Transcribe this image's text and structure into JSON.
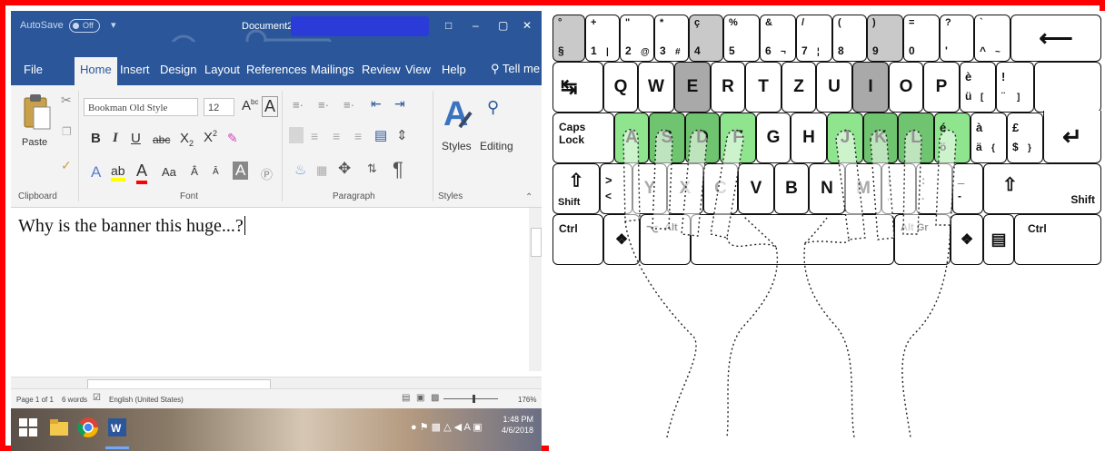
{
  "word": {
    "titlebar": {
      "autosave": "AutoSave",
      "autosave_state": "Off",
      "qat": "▾",
      "doc_title": "Document2 - Word",
      "win_restore": "□",
      "win_min": "–",
      "win_max": "▢",
      "win_close": "✕"
    },
    "tabs": [
      "File",
      "Home",
      "Insert",
      "Design",
      "Layout",
      "References",
      "Mailings",
      "Review",
      "View",
      "Help"
    ],
    "tell_me": "Tell me",
    "ribbon": {
      "paste": "Paste",
      "clipboard": "Clipboard",
      "font_name": "Bookman Old Style",
      "font_size": "12",
      "font": "Font",
      "paragraph": "Paragraph",
      "styles": "Styles",
      "styles_group": "Styles",
      "editing": "Editing"
    },
    "document_text": "Why is the banner this huge...?",
    "status": {
      "page": "Page 1 of 1",
      "words": "6 words",
      "language": "English (United States)",
      "zoom": "176%"
    },
    "taskbar": {
      "time": "1:48 PM",
      "date": "4/6/2018"
    }
  },
  "keyboard": {
    "row1": [
      {
        "top": "°",
        "bottom": "§"
      },
      {
        "top": "+",
        "bottom": "1",
        "alt": "|"
      },
      {
        "top": "\"",
        "bottom": "2",
        "alt": "@"
      },
      {
        "top": "*",
        "bottom": "3",
        "alt": "#"
      },
      {
        "top": "ç",
        "bottom": "4"
      },
      {
        "top": "%",
        "bottom": "5"
      },
      {
        "top": "&",
        "bottom": "6",
        "alt": "¬"
      },
      {
        "top": "/",
        "bottom": "7",
        "alt": "¦"
      },
      {
        "top": "(",
        "bottom": "8"
      },
      {
        "top": ")",
        "bottom": "9"
      },
      {
        "top": "=",
        "bottom": "0"
      },
      {
        "top": "?",
        "bottom": "'"
      },
      {
        "top": "`",
        "bottom": "^",
        "alt": "~"
      },
      {
        "main": "⟵"
      }
    ],
    "row2_tab": "↹",
    "row2": [
      "Q",
      "W",
      "E",
      "R",
      "T",
      "Z",
      "U",
      "I",
      "O",
      "P"
    ],
    "row2_extra": [
      {
        "top": "è",
        "bottom": "ü",
        "alt": "["
      },
      {
        "top": "!",
        "bottom": "¨",
        "alt": "]"
      }
    ],
    "caps_lock": "Caps Lock",
    "row3": [
      "A",
      "S",
      "D",
      "F",
      "G",
      "H",
      "J",
      "K",
      "L"
    ],
    "row3_extra": [
      {
        "top": "é",
        "bottom": "ö"
      },
      {
        "top": "à",
        "bottom": "ä",
        "alt": "{"
      },
      {
        "top": "£",
        "bottom": "$",
        "alt": "}"
      }
    ],
    "enter": "↵",
    "shift_left": "Shift",
    "shift_symbol": "⇧",
    "row4_lt": {
      "top": ">",
      "bottom": "<"
    },
    "row4": [
      "Y",
      "X",
      "C",
      "V",
      "B",
      "N",
      "M"
    ],
    "row4_extra": [
      {
        "top": ";",
        "bottom": ","
      },
      {
        "top": ":",
        "bottom": "."
      },
      {
        "top": "_",
        "bottom": "-"
      }
    ],
    "shift_right": "Shift",
    "ctrl_left": "Ctrl",
    "alt": "Alt",
    "altgr": "Alt Gr",
    "ctrl_right": "Ctrl"
  }
}
